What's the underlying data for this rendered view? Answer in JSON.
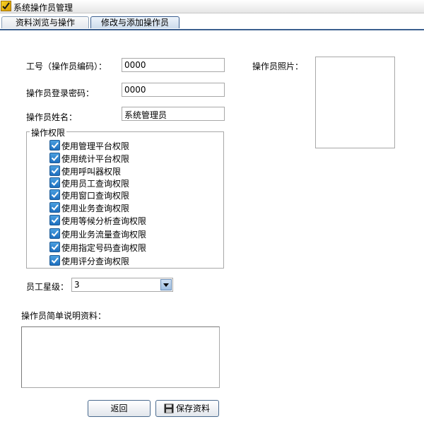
{
  "window": {
    "title": "系统操作员管理",
    "icon": "app-check-icon"
  },
  "tabs": [
    {
      "label": "资料浏览与操作",
      "active": false
    },
    {
      "label": "修改与添加操作员",
      "active": true
    }
  ],
  "form": {
    "id_label": "工号（操作员编码）：",
    "id_value": "0000",
    "password_label": "操作员登录密码：",
    "password_value": "0000",
    "name_label": "操作员姓名：",
    "name_value": "系统管理员",
    "photo_label": "操作员照片："
  },
  "permissions": {
    "title": "操作权限",
    "items": [
      {
        "label": "使用管理平台权限",
        "checked": true
      },
      {
        "label": "使用统计平台权限",
        "checked": true
      },
      {
        "label": "使用呼叫器权限",
        "checked": true
      },
      {
        "label": "使用员工查询权限",
        "checked": true
      },
      {
        "label": "使用窗口查询权限",
        "checked": true
      },
      {
        "label": "使用业务查询权限",
        "checked": true
      },
      {
        "label": "使用等候分析查询权限",
        "checked": true
      },
      {
        "label": "使用业务流量查询权限",
        "checked": true
      },
      {
        "label": "使用指定号码查询权限",
        "checked": true
      },
      {
        "label": "使用评分查询权限",
        "checked": true
      }
    ]
  },
  "star": {
    "label": "员工星级：",
    "value": "3"
  },
  "notes": {
    "label": "操作员简单说明资料：",
    "value": ""
  },
  "buttons": {
    "back": "返回",
    "save": "保存资料"
  },
  "colors": {
    "accent": "#3b5f8f",
    "checkbox": "#1d6fbf"
  }
}
